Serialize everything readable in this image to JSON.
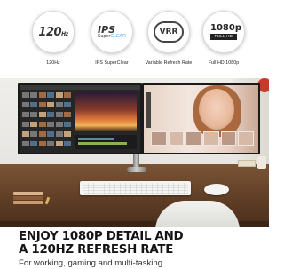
{
  "features": [
    {
      "icon": "refresh-rate-120hz-icon",
      "badge": "120",
      "badge_unit": "Hz",
      "caption": "120Hz"
    },
    {
      "icon": "ips-superclear-icon",
      "badge": "IPS",
      "badge_sub_a": "Super",
      "badge_sub_b": "CLEAR",
      "caption": "IPS SuperClear"
    },
    {
      "icon": "vrr-icon",
      "badge": "VRR",
      "caption": "Variable Refresh Rate"
    },
    {
      "icon": "full-hd-1080p-icon",
      "badge": "1080p",
      "badge_sub": "FULL HD",
      "caption": "Full HD 1080p"
    }
  ],
  "headline": {
    "line1": "ENJOY 1080P DETAIL AND",
    "line2": "A 120HZ REFRESH RATE",
    "subtitle": "For working, gaming and multi-tasking"
  },
  "colors": {
    "accent_blue": "#4aa3e0",
    "desk_brown": "#5d3c24"
  }
}
